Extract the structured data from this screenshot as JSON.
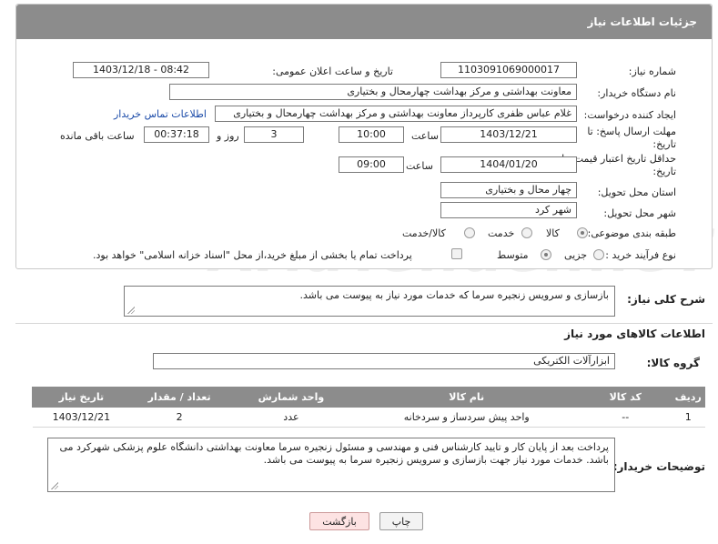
{
  "header": {
    "title": "جزئیات اطلاعات نیاز"
  },
  "fields": {
    "need_number_label": "شماره نیاز:",
    "need_number": "1103091069000017",
    "announce_label": "تاریخ و ساعت اعلان عمومی:",
    "announce_value": "1403/12/18 - 08:42",
    "buyer_org_label": "نام دستگاه خریدار:",
    "buyer_org": "معاونت  بهداشتی  و مرکز بهداشت چهارمحال و بختیاری",
    "requester_label": "ایجاد کننده درخواست:",
    "requester": "غلام عباس ظفری کارپرداز معاونت  بهداشتی  و مرکز بهداشت چهارمحال و بختیاری",
    "contact_link": "اطلاعات تماس خریدار",
    "reply_deadline_label_1": "مهلت ارسال پاسخ: تا",
    "reply_deadline_label_2": "تاریخ:",
    "reply_date": "1403/12/21",
    "time_label": "ساعت",
    "reply_time": "10:00",
    "days_value": "3",
    "days_label": "روز و",
    "remaining_time": "00:37:18",
    "remaining_label": "ساعت باقی مانده",
    "min_price_label_1": "حداقل تاریخ اعتبار قیمت: تا",
    "min_price_label_2": "تاریخ:",
    "price_date": "1404/01/20",
    "price_time": "09:00",
    "province_label": "استان محل تحویل:",
    "province": "چهار محال و بختیاری",
    "city_label": "شهر محل تحویل:",
    "city": "شهر کرد",
    "category_label": "طبقه بندی موضوعی:",
    "category_options": [
      "کالا",
      "خدمت",
      "کالا/خدمت"
    ],
    "process_label": "نوع فرآیند خرید :",
    "process_options": [
      "جزیی",
      "متوسط"
    ],
    "payment_note": "پرداخت تمام یا بخشی از مبلغ خرید،از محل \"اسناد خزانه اسلامی\" خواهد بود."
  },
  "description": {
    "label": "شرح کلی نیاز:",
    "text": "بازسازی و سرویس زنجیره سرما که خدمات مورد نیاز به پیوست می باشد."
  },
  "goods": {
    "section_title": "اطلاعات کالاهای مورد نیاز",
    "group_label": "گروه کالا:",
    "group_value": "ابزارآلات الکتریکی",
    "columns": [
      "ردیف",
      "کد کالا",
      "نام کالا",
      "واحد شمارش",
      "تعداد / مقدار",
      "تاریخ نیاز"
    ],
    "rows": [
      [
        "1",
        "--",
        "واحد پیش سردساز و سردخانه",
        "عدد",
        "2",
        "1403/12/21"
      ]
    ]
  },
  "buyer_notes": {
    "label": "توضیحات خریدار:",
    "text": "پرداخت بعد از پایان کار و تایید کارشناس فنی و مهندسی و مسئول زنجیره سرما معاونت بهداشتی دانشگاه علوم پزشکی شهرکرد می باشد. خدمات مورد نیاز جهت بازسازی و سرویس زنجیره سرما به پیوست می باشد."
  },
  "buttons": {
    "print": "چاپ",
    "back": "بازگشت"
  },
  "watermark": "AriaTender.neT"
}
